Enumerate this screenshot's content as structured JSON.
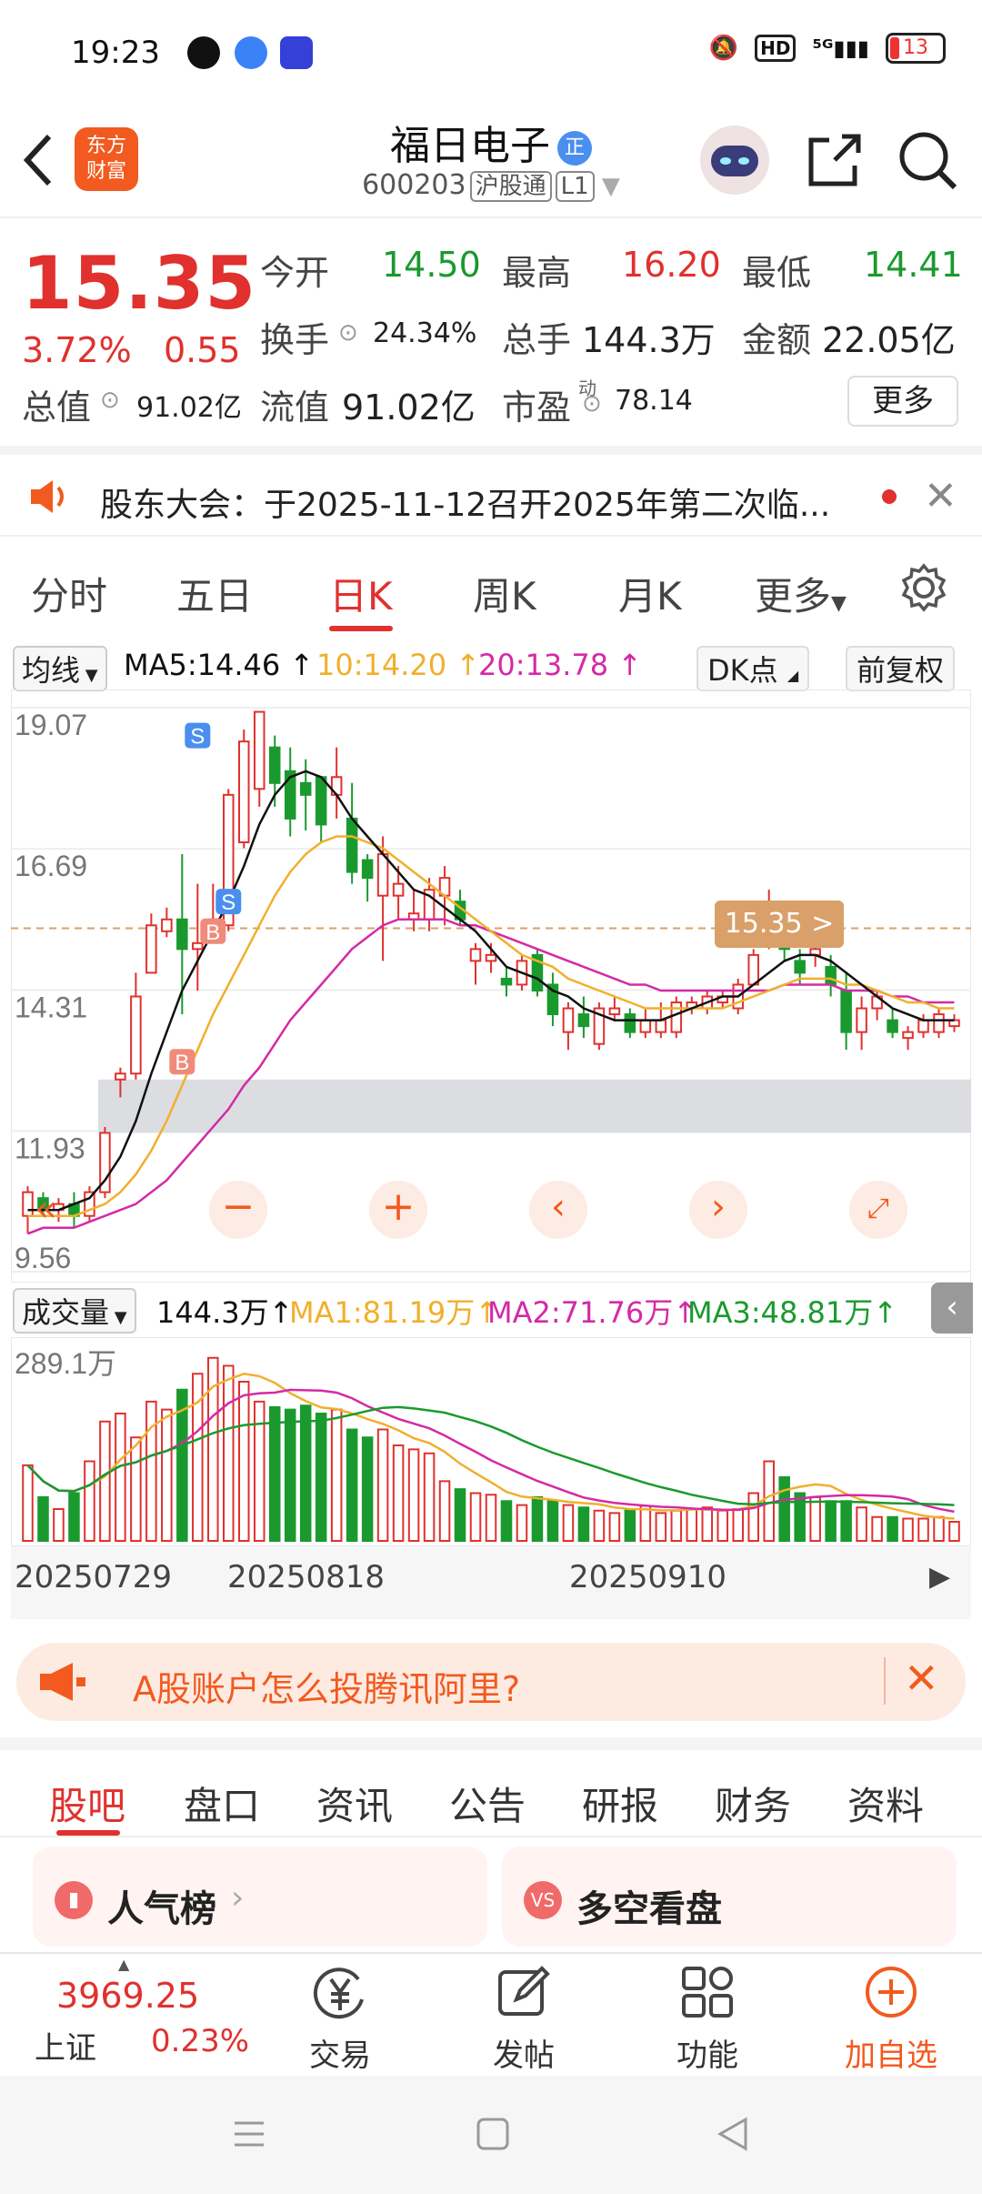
{
  "status": {
    "time": "19:23",
    "battery": "13"
  },
  "header": {
    "logo": "东方\n财富",
    "title": "福日电子",
    "title_badge": "正",
    "code": "600203",
    "tag1": "沪股通",
    "tag2": "L1"
  },
  "quote": {
    "price": "15.35",
    "pct": "3.72%",
    "change": "0.55",
    "open_label": "今开",
    "open": "14.50",
    "high_label": "最高",
    "high": "16.20",
    "low_label": "最低",
    "low": "14.41",
    "turnover_label": "换手",
    "turnover": "24.34%",
    "vol_label": "总手",
    "vol": "144.3万",
    "amount_label": "金额",
    "amount": "22.05亿",
    "mcap_label": "总值",
    "mcap": "91.02亿",
    "float_label": "流值",
    "float": "91.02亿",
    "pe_label": "市盈",
    "pe_sup": "动",
    "pe": "78.14",
    "more": "更多"
  },
  "notice": {
    "text": "股东大会：于2025-11-12召开2025年第二次临..."
  },
  "tabs": [
    "分时",
    "五日",
    "日K",
    "周K",
    "月K",
    "更多"
  ],
  "ma": {
    "type": "均线",
    "ma5": "MA5:14.46",
    "ma10": "10:14.20",
    "ma20": "20:13.78",
    "dk": "DK点",
    "adj": "前复权"
  },
  "chart_data": {
    "type": "candlestick",
    "y_ticks": [
      "19.07",
      "16.69",
      "14.31",
      "11.93",
      "9.56"
    ],
    "price_label": "15.35 >",
    "x_ticks": [
      "20250729",
      "20250818",
      "20250910"
    ],
    "candles": [
      [
        10.5,
        11.0,
        10.2,
        10.9
      ],
      [
        10.8,
        10.9,
        10.5,
        10.6
      ],
      [
        10.6,
        10.8,
        10.4,
        10.7
      ],
      [
        10.7,
        10.9,
        10.3,
        10.5
      ],
      [
        10.5,
        11.0,
        10.4,
        10.9
      ],
      [
        10.9,
        12.0,
        10.8,
        11.9
      ],
      [
        12.8,
        13.0,
        12.5,
        12.9
      ],
      [
        12.9,
        14.6,
        12.8,
        14.2
      ],
      [
        14.6,
        15.6,
        14.6,
        15.4
      ],
      [
        15.3,
        15.7,
        15.2,
        15.5
      ],
      [
        15.5,
        16.6,
        13.9,
        15.0
      ],
      [
        15.0,
        16.1,
        14.3,
        15.1
      ],
      [
        15.2,
        16.1,
        15.1,
        15.5
      ],
      [
        15.4,
        17.7,
        15.3,
        17.6
      ],
      [
        16.8,
        18.7,
        16.7,
        18.5
      ],
      [
        17.7,
        19.0,
        17.4,
        19.0
      ],
      [
        18.4,
        18.6,
        17.4,
        17.8
      ],
      [
        18.0,
        18.4,
        16.9,
        17.2
      ],
      [
        17.8,
        18.2,
        17.0,
        17.6
      ],
      [
        17.9,
        17.9,
        16.8,
        17.1
      ],
      [
        17.6,
        18.4,
        17.2,
        17.9
      ],
      [
        17.2,
        17.8,
        16.1,
        16.3
      ],
      [
        16.5,
        16.6,
        15.8,
        16.2
      ],
      [
        15.9,
        16.9,
        14.8,
        16.6
      ],
      [
        15.9,
        16.4,
        15.5,
        16.1
      ],
      [
        15.5,
        16.0,
        15.3,
        15.6
      ],
      [
        15.5,
        16.2,
        15.3,
        16.0
      ],
      [
        15.9,
        16.4,
        15.4,
        16.2
      ],
      [
        15.8,
        16.0,
        15.4,
        15.5
      ],
      [
        14.8,
        15.1,
        14.4,
        15.0
      ],
      [
        14.8,
        15.1,
        14.6,
        14.9
      ],
      [
        14.5,
        14.7,
        14.2,
        14.4
      ],
      [
        14.4,
        14.9,
        14.3,
        14.8
      ],
      [
        14.9,
        15.0,
        14.2,
        14.3
      ],
      [
        14.4,
        14.6,
        13.7,
        13.9
      ],
      [
        13.6,
        14.1,
        13.3,
        14.0
      ],
      [
        13.9,
        14.2,
        13.5,
        13.7
      ],
      [
        13.4,
        14.1,
        13.3,
        14.0
      ],
      [
        13.9,
        14.2,
        13.8,
        14.0
      ],
      [
        13.9,
        14.0,
        13.5,
        13.6
      ],
      [
        13.6,
        14.0,
        13.5,
        13.8
      ],
      [
        13.6,
        14.1,
        13.5,
        13.8
      ],
      [
        13.6,
        14.2,
        13.5,
        14.1
      ],
      [
        14.0,
        14.2,
        13.9,
        14.1
      ],
      [
        14.0,
        14.3,
        13.9,
        14.2
      ],
      [
        14.1,
        14.3,
        14.0,
        14.2
      ],
      [
        14.0,
        14.5,
        13.9,
        14.4
      ],
      [
        14.4,
        15.0,
        14.4,
        14.9
      ],
      [
        15.2,
        16.0,
        15.0,
        15.6
      ],
      [
        15.4,
        15.6,
        14.8,
        15.0
      ],
      [
        14.8,
        15.0,
        14.4,
        14.6
      ],
      [
        14.9,
        15.3,
        14.7,
        15.0
      ],
      [
        14.7,
        14.9,
        14.2,
        14.4
      ],
      [
        14.3,
        14.6,
        13.3,
        13.6
      ],
      [
        13.6,
        14.2,
        13.3,
        14.0
      ],
      [
        14.0,
        14.3,
        13.8,
        14.2
      ],
      [
        13.8,
        14.0,
        13.5,
        13.6
      ],
      [
        13.5,
        13.7,
        13.3,
        13.6
      ],
      [
        13.6,
        13.9,
        13.5,
        13.8
      ],
      [
        13.6,
        14.0,
        13.5,
        13.9
      ],
      [
        13.7,
        13.9,
        13.6,
        13.8
      ]
    ],
    "volumes": [
      95,
      55,
      40,
      60,
      100,
      150,
      160,
      130,
      175,
      165,
      190,
      210,
      230,
      220,
      200,
      175,
      168,
      165,
      170,
      160,
      165,
      140,
      130,
      140,
      120,
      115,
      110,
      75,
      65,
      60,
      58,
      50,
      45,
      55,
      50,
      45,
      42,
      38,
      35,
      40,
      44,
      35,
      38,
      40,
      42,
      38,
      40,
      60,
      100,
      80,
      60,
      55,
      50,
      50,
      42,
      30,
      30,
      28,
      28,
      30,
      24
    ],
    "ma5": [
      10.6,
      10.6,
      10.6,
      10.7,
      10.8,
      11.1,
      11.5,
      12.1,
      12.9,
      13.6,
      14.3,
      14.8,
      15.3,
      15.8,
      16.4,
      17.1,
      17.6,
      17.9,
      18.0,
      17.9,
      17.6,
      17.2,
      16.9,
      16.6,
      16.3,
      16.0,
      15.9,
      15.7,
      15.5,
      15.3,
      15.0,
      14.7,
      14.6,
      14.5,
      14.3,
      14.2,
      14.0,
      13.9,
      13.8,
      13.8,
      13.8,
      13.8,
      13.9,
      14.0,
      14.1,
      14.2,
      14.2,
      14.4,
      14.6,
      14.8,
      14.9,
      14.9,
      14.8,
      14.6,
      14.4,
      14.2,
      14.0,
      13.9,
      13.8,
      13.8,
      13.8
    ],
    "ma10": [
      10.5,
      10.5,
      10.5,
      10.5,
      10.6,
      10.7,
      10.9,
      11.2,
      11.6,
      12.1,
      12.7,
      13.3,
      13.9,
      14.4,
      14.9,
      15.4,
      15.9,
      16.3,
      16.6,
      16.8,
      16.9,
      16.9,
      16.8,
      16.7,
      16.5,
      16.3,
      16.1,
      15.9,
      15.7,
      15.5,
      15.3,
      15.1,
      14.9,
      14.8,
      14.7,
      14.5,
      14.4,
      14.3,
      14.2,
      14.1,
      14.0,
      14.0,
      14.0,
      14.0,
      14.0,
      14.0,
      14.1,
      14.2,
      14.3,
      14.4,
      14.5,
      14.5,
      14.5,
      14.4,
      14.4,
      14.3,
      14.2,
      14.1,
      14.1,
      14.0,
      14.0
    ],
    "ma20": [
      10.2,
      10.3,
      10.3,
      10.3,
      10.4,
      10.5,
      10.6,
      10.7,
      10.9,
      11.1,
      11.4,
      11.7,
      12.0,
      12.3,
      12.7,
      13.0,
      13.4,
      13.8,
      14.1,
      14.4,
      14.7,
      15.0,
      15.2,
      15.4,
      15.5,
      15.5,
      15.5,
      15.5,
      15.4,
      15.4,
      15.3,
      15.2,
      15.1,
      15.0,
      14.9,
      14.8,
      14.7,
      14.6,
      14.5,
      14.4,
      14.4,
      14.3,
      14.3,
      14.3,
      14.3,
      14.3,
      14.3,
      14.3,
      14.3,
      14.4,
      14.4,
      14.4,
      14.4,
      14.3,
      14.3,
      14.3,
      14.2,
      14.2,
      14.1,
      14.1,
      14.1
    ],
    "ylim": [
      9.56,
      19.07
    ],
    "vol_max_label": "289.1万"
  },
  "volbar": {
    "label": "成交量",
    "vol": "144.3万",
    "ma1": "MA1:81.19万",
    "ma2": "MA2:71.76万",
    "ma3": "MA3:48.81万"
  },
  "ad": {
    "text": "A股账户怎么投腾讯阿里?"
  },
  "btabs": [
    "股吧",
    "盘口",
    "资讯",
    "公告",
    "研报",
    "财务",
    "资料"
  ],
  "cards": {
    "left": "人气榜",
    "right": "多空看盘"
  },
  "bottom": {
    "index": "3969.25",
    "index_name": "上证",
    "index_pct": "0.23%",
    "trade": "交易",
    "post": "发帖",
    "func": "功能",
    "add": "加自选"
  },
  "colors": {
    "up": "#e0312e",
    "down": "#1a9a2e",
    "ma5": "#111111",
    "ma10": "#f0b02c",
    "ma20": "#d42aa6"
  }
}
